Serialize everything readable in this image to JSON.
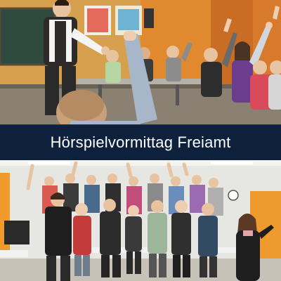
{
  "banner": {
    "title": "Hörspielvormittag Freiamt"
  },
  "photos": {
    "top": {
      "subject": "classroom-kids-raising-hands",
      "colors": {
        "wall": "#d7a04f",
        "chalkboard": "#2f4a3e",
        "floor": "#8b8173"
      }
    },
    "bottom": {
      "subject": "group-standing-hands-raised",
      "colors": {
        "wall": "#e6e6e2",
        "accent": "#ee9a2d",
        "floor": "#c7c2b7"
      }
    }
  },
  "colors": {
    "banner_bg": "#0d213d",
    "banner_text": "#ffffff",
    "page_bg": "#0b1c34"
  }
}
